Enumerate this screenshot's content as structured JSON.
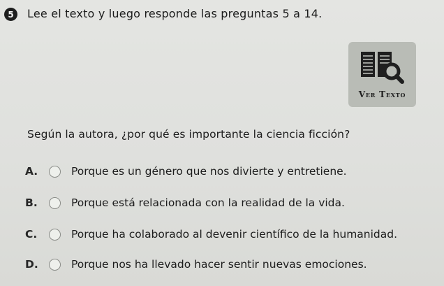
{
  "question_number": "5",
  "instruction": "Lee el texto y luego responde las preguntas 5 a 14.",
  "ver_texto": {
    "label": "Ver Texto",
    "icon": "document-search-icon"
  },
  "question": "Según la autora, ¿por qué es importante la ciencia ficción?",
  "options": [
    {
      "letter": "A.",
      "text": "Porque es un género que nos divierte y entretiene."
    },
    {
      "letter": "B.",
      "text": "Porque está relacionada con la realidad de la vida."
    },
    {
      "letter": "C.",
      "text": "Porque ha colaborado al devenir científico de la humanidad."
    },
    {
      "letter": "D.",
      "text": "Porque nos ha llevado hacer sentir nuevas emociones."
    }
  ]
}
